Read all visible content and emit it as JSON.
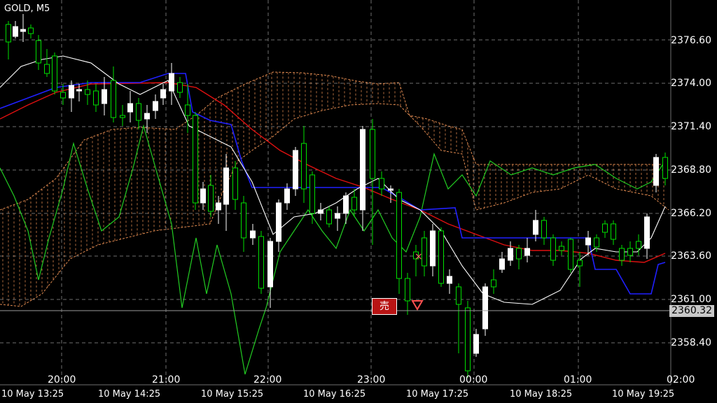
{
  "header": {
    "symbol": "GOLD, M5"
  },
  "price_axis": [
    "2376.60",
    "2374.00",
    "2371.40",
    "2368.80",
    "2366.20",
    "2363.60",
    "2361.00",
    "2358.40"
  ],
  "current_price": "2360.32",
  "time_axis_top": [
    "20:00",
    "21:00",
    "22:00",
    "23:00",
    "00:00",
    "01:00",
    "02:00"
  ],
  "time_axis_bottom": [
    "10 May 13:25",
    "10 May 14:25",
    "10 May 15:25",
    "10 May 16:25",
    "10 May 17:25",
    "10 May 18:25",
    "10 May 19:25"
  ],
  "sell_badge": "売",
  "colors": {
    "bull": "#ffffff",
    "bear": "#00e000",
    "grid": "#6e6e6e",
    "ma_red": "#e01010",
    "ma_blue": "#2020ff",
    "ma_white": "#ffffff",
    "ma_green": "#22cc22",
    "cloud": "#e08a50",
    "cur_line": "#9a9a9a"
  }
}
